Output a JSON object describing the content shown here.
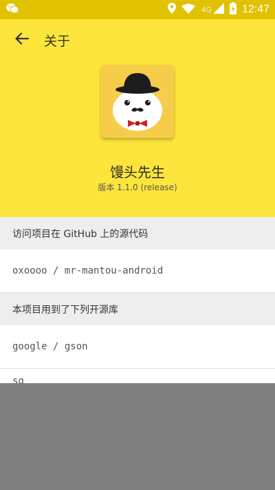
{
  "status_bar": {
    "network": "4G",
    "time": "12:47",
    "icons": [
      "wechat-icon",
      "location-icon",
      "wifi-icon",
      "signal-icon",
      "battery-icon"
    ]
  },
  "toolbar": {
    "title": "关于"
  },
  "app": {
    "name": "馒头先生",
    "version": "版本 1.1.0 (release)"
  },
  "sections": [
    {
      "header": "访问项目在 GitHub 上的源代码",
      "rows": [
        "oxoooo / mr-mantou-android"
      ]
    },
    {
      "header": "本项目用到了下列开源库",
      "rows": [
        "google / gson",
        "sq"
      ]
    }
  ],
  "colors": {
    "status_bar": "#e0c200",
    "header": "#fde53b",
    "icon_bg": "#f6cd4a",
    "section_bg": "#eeeeee"
  }
}
